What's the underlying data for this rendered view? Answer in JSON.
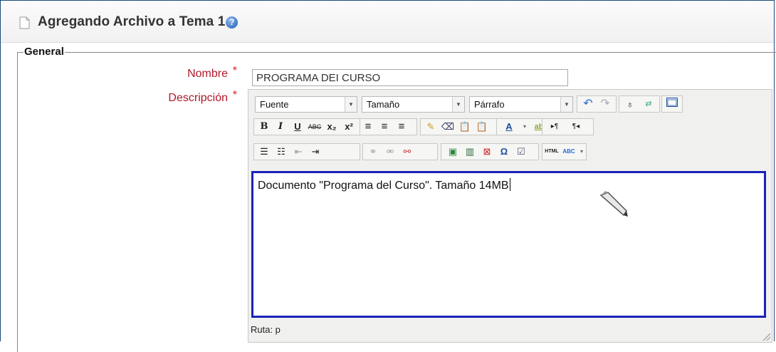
{
  "header": {
    "title": "Agregando Archivo a Tema 1",
    "help": "?"
  },
  "section": {
    "legend": "General"
  },
  "form": {
    "name_label": "Nombre",
    "name_value": "PROGRAMA DEI CURSO",
    "desc_label": "Descripción",
    "required": "*"
  },
  "editor": {
    "font_select": "Fuente",
    "size_select": "Tamaño",
    "format_select": "Párrafo",
    "content": "Documento \"Programa del Curso\". Tamaño 14MB",
    "status_path": "Ruta: p",
    "row2_labels": {
      "bold": "B",
      "italic": "I",
      "underline": "U",
      "strike": "ABC",
      "subscript": "x₂",
      "superscript": "x²"
    },
    "row3_labels": {
      "html": "HTML",
      "spell": "ABC"
    },
    "row1_labels": {
      "font_color": "A",
      "highlight": "ab",
      "ltr": "▸¶",
      "rtl": "¶◂"
    }
  },
  "colors": {
    "border": "#1a4a7a",
    "required": "#b0182a",
    "editor_focus": "#1a23b8"
  }
}
